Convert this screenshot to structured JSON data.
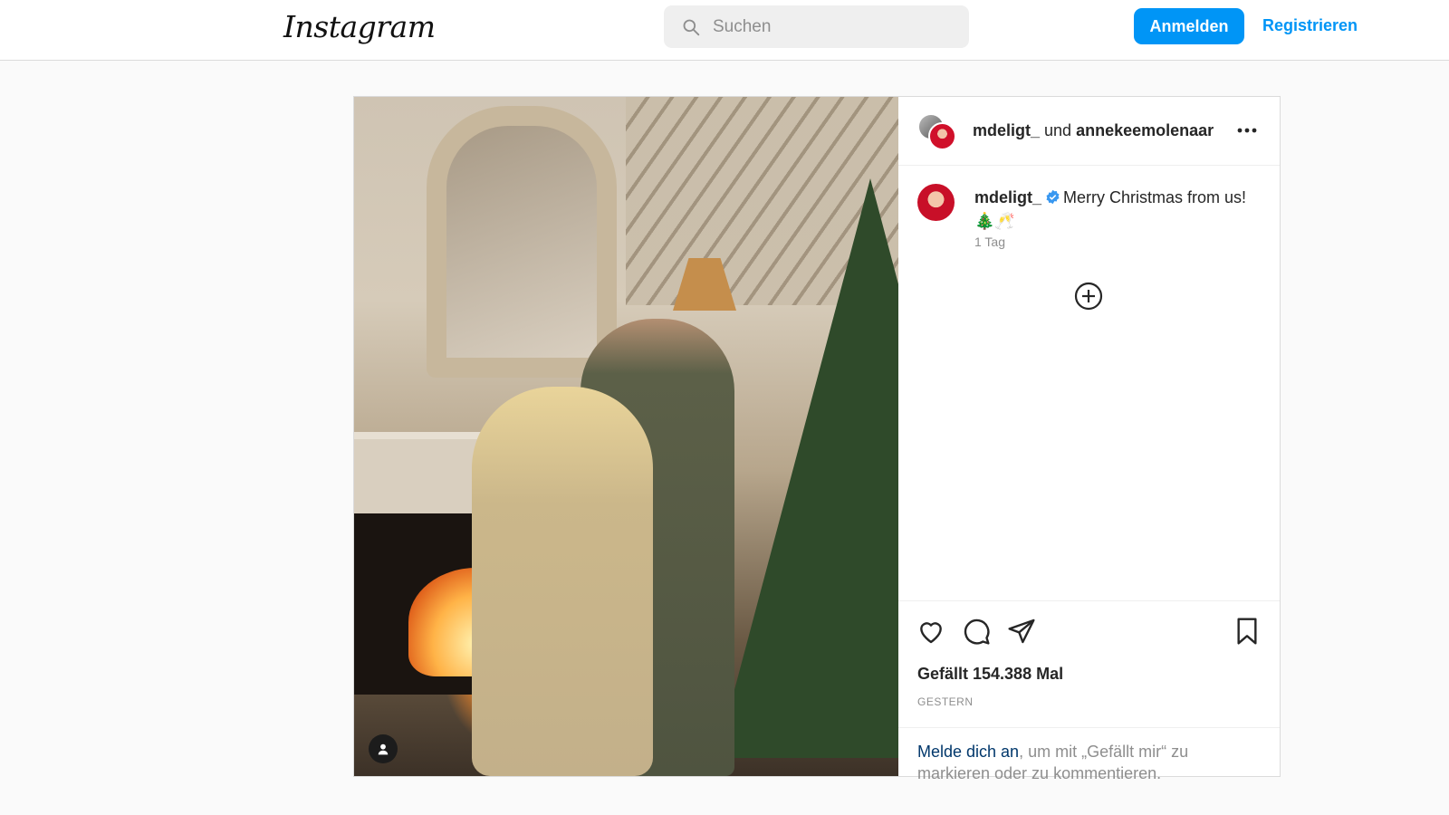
{
  "header": {
    "logo_text": "Instagram",
    "search_placeholder": "Suchen",
    "login_label": "Anmelden",
    "register_label": "Registrieren"
  },
  "post": {
    "header_user1": "mdeligt_",
    "header_connector": "und",
    "header_user2": "annekeemolenaar",
    "caption_user": "mdeligt_",
    "caption_text": "Merry Christmas from us!",
    "caption_emojis": "🎄🥂",
    "caption_time": "1 Tag",
    "likes": "Gefällt 154.388 Mal",
    "date": "GESTERN"
  },
  "footer_prompt": {
    "link": "Melde dich an",
    "rest": ", um mit „Gefällt mir“ zu markieren oder zu kommentieren."
  },
  "colors": {
    "accent": "#0095f6",
    "verified": "#3897f0"
  },
  "icons": [
    "search-icon",
    "more-options-icon",
    "verified-badge-icon",
    "add-comment-icon",
    "heart-icon",
    "comment-icon",
    "share-icon",
    "bookmark-icon",
    "user-tag-icon"
  ]
}
